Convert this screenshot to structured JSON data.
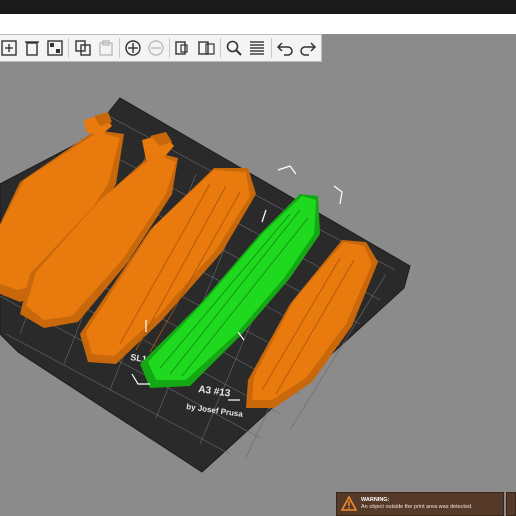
{
  "toolbar": {
    "buttons": [
      {
        "name": "add-icon",
        "disabled": false
      },
      {
        "name": "delete-icon",
        "disabled": false
      },
      {
        "name": "delete-all-icon",
        "disabled": false
      },
      {
        "name": "arrange-icon",
        "disabled": false
      },
      {
        "name": "copy-icon",
        "disabled": false
      },
      {
        "name": "paste-icon",
        "disabled": true
      },
      {
        "name": "add-instance-icon",
        "disabled": false
      },
      {
        "name": "remove-instance-icon",
        "disabled": true
      },
      {
        "name": "split-objects-icon",
        "disabled": false
      },
      {
        "name": "split-parts-icon",
        "disabled": false
      },
      {
        "name": "search-icon",
        "disabled": false
      },
      {
        "name": "layers-icon",
        "disabled": false
      },
      {
        "name": "undo-icon",
        "disabled": false
      },
      {
        "name": "redo-icon",
        "disabled": false
      }
    ]
  },
  "bed": {
    "label_line1": "SL1S",
    "label_line2": "A3 #13",
    "label_line3": "by Josef Prusa"
  },
  "warning": {
    "title": "WARNING:",
    "message": "An object outside the print area was detected."
  },
  "colors": {
    "object_orange": "#e87a0e",
    "object_selected": "#1fd91f",
    "bed": "#2a2a2a",
    "viewport_bg": "#8b8b8b",
    "warning_bg": "#553a2a"
  }
}
